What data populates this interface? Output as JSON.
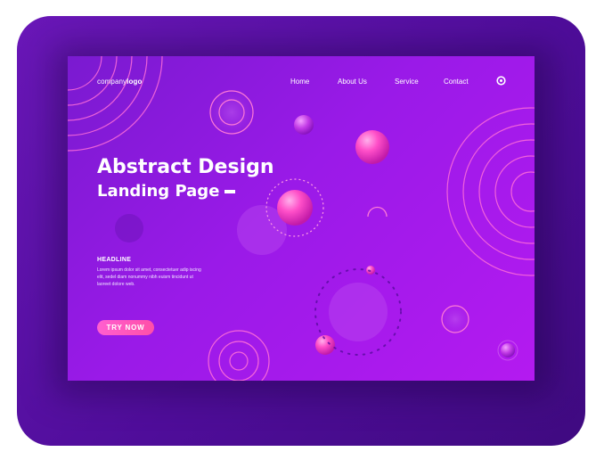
{
  "brand": {
    "logo_light": "company",
    "logo_bold": "logo"
  },
  "nav": {
    "items": [
      {
        "label": "Home"
      },
      {
        "label": "About Us"
      },
      {
        "label": "Service"
      },
      {
        "label": "Contact"
      }
    ],
    "search_icon": "search-icon"
  },
  "hero": {
    "title": "Abstract Design",
    "subtitle": "Landing Page"
  },
  "section": {
    "headline": "HEADLINE",
    "body": "Lorem ipsum dolor sit amet, consectetuer adip iscing elit, sedel diam nonummy nibh euism tincidunt ut laoreet dolore web."
  },
  "cta": {
    "label": "TRY NOW"
  },
  "colors": {
    "frame": "#5a10a8",
    "card_start": "#7a1ad0",
    "card_end": "#b41af0",
    "accent_pink": "#ff4fb8"
  }
}
